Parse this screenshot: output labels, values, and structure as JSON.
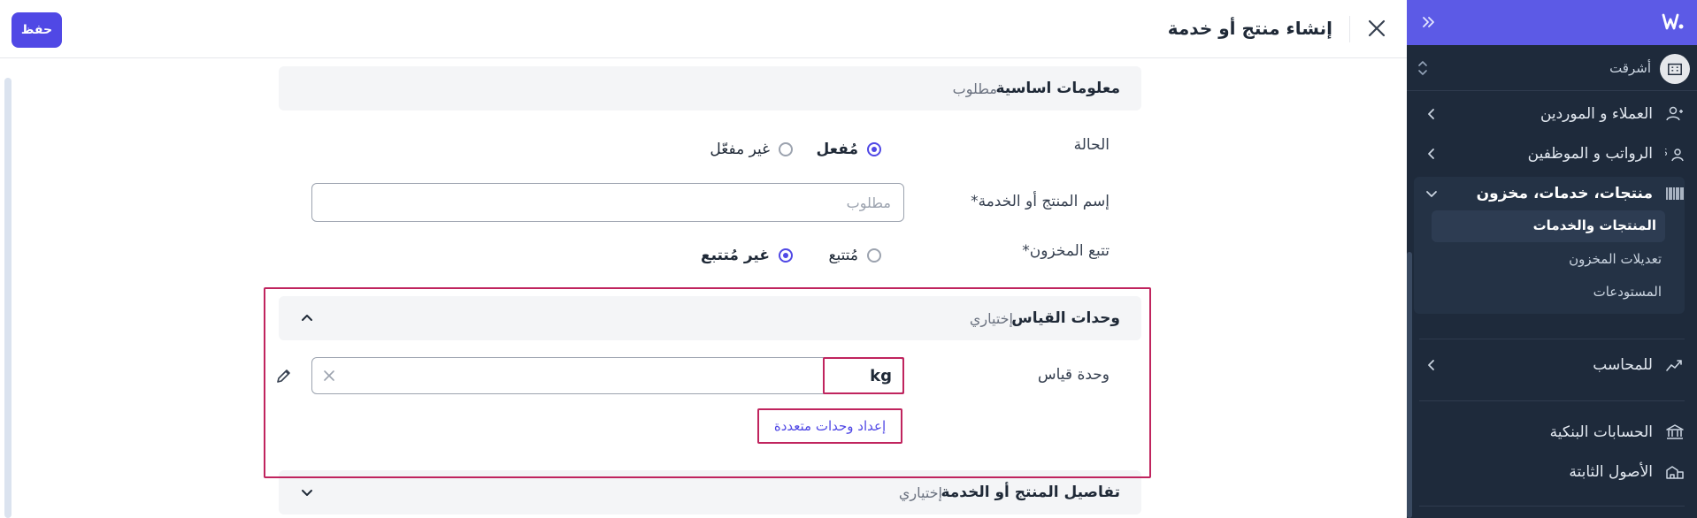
{
  "header": {
    "save_label": "حفظ",
    "title": "إنشاء منتج أو خدمة"
  },
  "sidebar": {
    "org_name": "أشرقت",
    "items": [
      {
        "label": "العملاء و الموردين",
        "icon": "users-icon"
      },
      {
        "label": "الرواتب و الموظفين",
        "icon": "payroll-icon"
      },
      {
        "label": "منتجات، خدمات، مخزون",
        "icon": "barcode-icon"
      },
      {
        "label": "للمحاسب",
        "icon": "chart-icon"
      },
      {
        "label": "الحسابات البنكية",
        "icon": "bank-icon"
      },
      {
        "label": "الأصول الثابتة",
        "icon": "assets-icon"
      }
    ],
    "subitems": [
      {
        "label": "المنتجات والخدمات",
        "active": true
      },
      {
        "label": "تعديلات المخزون",
        "active": false
      },
      {
        "label": "المستودعات",
        "active": false
      }
    ]
  },
  "form": {
    "basic": {
      "title": "معلومات اساسية",
      "hint": "مطلوب"
    },
    "status": {
      "label": "الحالة",
      "options": [
        {
          "label": "مُفعل",
          "selected": true
        },
        {
          "label": "غير مفعّل",
          "selected": false
        }
      ]
    },
    "name": {
      "label": "إسم المنتج أو الخدمة*",
      "placeholder": "مطلوب",
      "value": ""
    },
    "tracking": {
      "label": "تتبع المخزون*",
      "options": [
        {
          "label": "مُتتبع",
          "selected": false
        },
        {
          "label": "غير مُتتبع",
          "selected": true
        }
      ]
    },
    "units": {
      "title": "وحدات القياس",
      "hint": "إختياري",
      "field_label": "وحدة قياس",
      "value": "kg",
      "multi_link": "إعداد وحدات متعددة"
    },
    "details": {
      "title": "تفاصيل المنتج أو الخدمة",
      "hint": "إختياري"
    }
  }
}
